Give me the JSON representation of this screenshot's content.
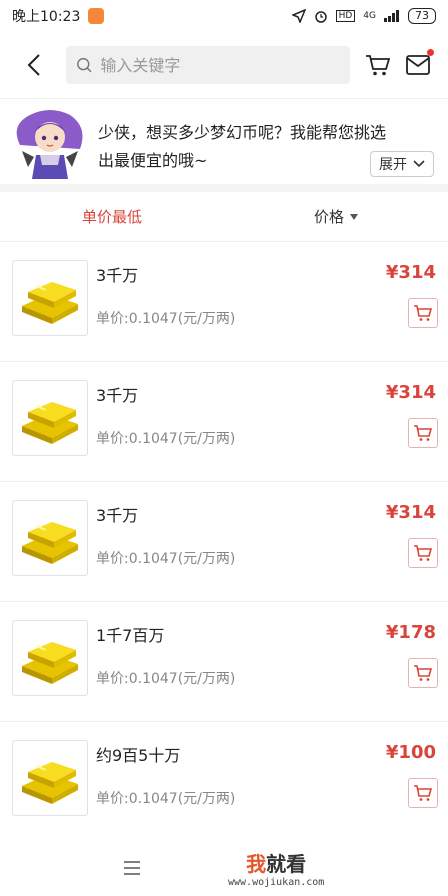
{
  "status_bar": {
    "time": "晚上10:23",
    "network": "4G",
    "battery": "73",
    "app_badge_color": "#f5863a"
  },
  "header": {
    "search_placeholder": "输入关键字"
  },
  "banner": {
    "message": "少侠，想买多少梦幻币呢？我能帮您挑选出最便宜的哦~",
    "expand_label": "展开"
  },
  "sort": {
    "tabs": [
      {
        "label": "单价最低",
        "active": true
      },
      {
        "label": "价格",
        "active": false
      }
    ]
  },
  "items": [
    {
      "name": "3千万",
      "unit_price": "单价:0.1047(元/万两)",
      "price": "¥314"
    },
    {
      "name": "3千万",
      "unit_price": "单价:0.1047(元/万两)",
      "price": "¥314"
    },
    {
      "name": "3千万",
      "unit_price": "单价:0.1047(元/万两)",
      "price": "¥314"
    },
    {
      "name": "1千7百万",
      "unit_price": "单价:0.1047(元/万两)",
      "price": "¥178"
    },
    {
      "name": "约9百5十万",
      "unit_price": "单价:0.1047(元/万两)",
      "price": "¥100"
    }
  ],
  "watermark": {
    "title_accent": "我",
    "title_rest": "就看",
    "url": "www.wojiukan.com"
  },
  "colors": {
    "accent": "#d9443b"
  }
}
